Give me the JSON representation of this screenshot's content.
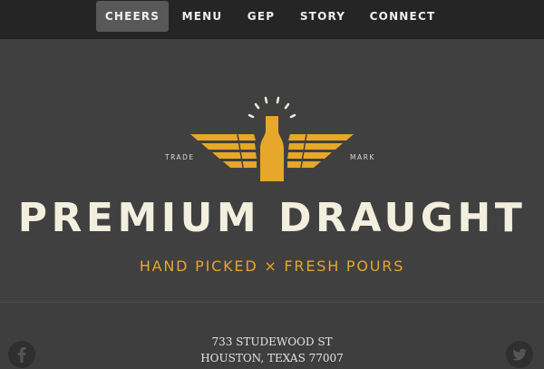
{
  "nav": {
    "items": [
      {
        "label": "CHEERS",
        "active": true
      },
      {
        "label": "MENU",
        "active": false
      },
      {
        "label": "GEP",
        "active": false
      },
      {
        "label": "STORY",
        "active": false
      },
      {
        "label": "CONNECT",
        "active": false
      }
    ]
  },
  "hero": {
    "logo": {
      "left_text": "TRADE",
      "right_text": "MARK",
      "icon": "winged-bottle-icon"
    },
    "title": "PREMIUM DRAUGHT",
    "subtitle": "HAND PICKED × FRESH POURS"
  },
  "footer": {
    "address_line1": "733 STUDEWOOD ST",
    "address_line2": "HOUSTON, TEXAS 77007",
    "social": [
      {
        "icon": "facebook-icon"
      },
      {
        "icon": "twitter-icon"
      }
    ]
  },
  "colors": {
    "accent": "#e6a72a",
    "title": "#f2efdf",
    "nav_bg": "#252525",
    "page_bg": "#404040"
  }
}
